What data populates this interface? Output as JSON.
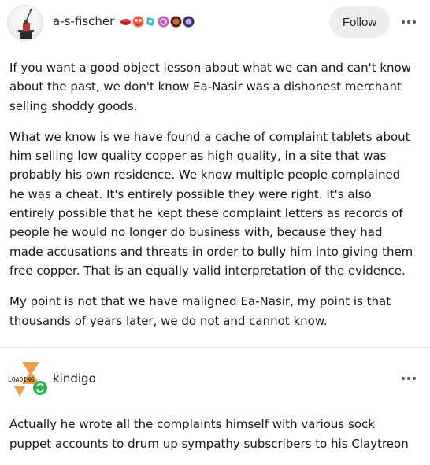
{
  "post": {
    "username": "a-s-fischer",
    "follow_label": "Follow",
    "badges": [
      {
        "icon": "lips-badge-icon",
        "color": "#e33b3b"
      },
      {
        "icon": "heart-eyes-badge-icon",
        "color": "#ff4b3a"
      },
      {
        "icon": "cyan-sparkle-badge-icon",
        "color": "#39c0d6"
      },
      {
        "icon": "pink-swirl-badge-icon",
        "color": "#c257c6"
      },
      {
        "icon": "dark-orange-badge-icon",
        "color": "#c7461d"
      },
      {
        "icon": "purple-moon-badge-icon",
        "color": "#6a53b5"
      }
    ],
    "paragraphs": [
      {
        "lines": [
          "If you want a good object lesson about what we can and can't know",
          "about the past, we don't know Ea-Nasir was a dishonest merchant",
          "selling shoddy goods."
        ]
      },
      {
        "lines": [
          "What we know is we have found a cache of complaint tablets about",
          "him selling low quality copper as high quality, in a site that was",
          "probably his own residence.  We know multiple people complained",
          "he was a cheat.  It's entirely possible they were right.  It's also",
          "entirely possible that he kept these complaint letters as records of",
          "people he would no longer do business with, because they had",
          "made accusations and threats in order to bully him into giving them",
          "free copper.  That is an equally valid interpretation of the evidence."
        ]
      },
      {
        "lines": [
          "My point is not that we have maligned Ea-Nasir, my point is that",
          "thousands of years later, we do not and cannot know."
        ]
      }
    ]
  },
  "reply": {
    "username": "kindigo",
    "avatar_text": "LOADING",
    "lines": [
      "Actually he wrote all the complaints himself with various sock",
      "puppet accounts to drum up sympathy subscribers to his Claytreon"
    ]
  }
}
